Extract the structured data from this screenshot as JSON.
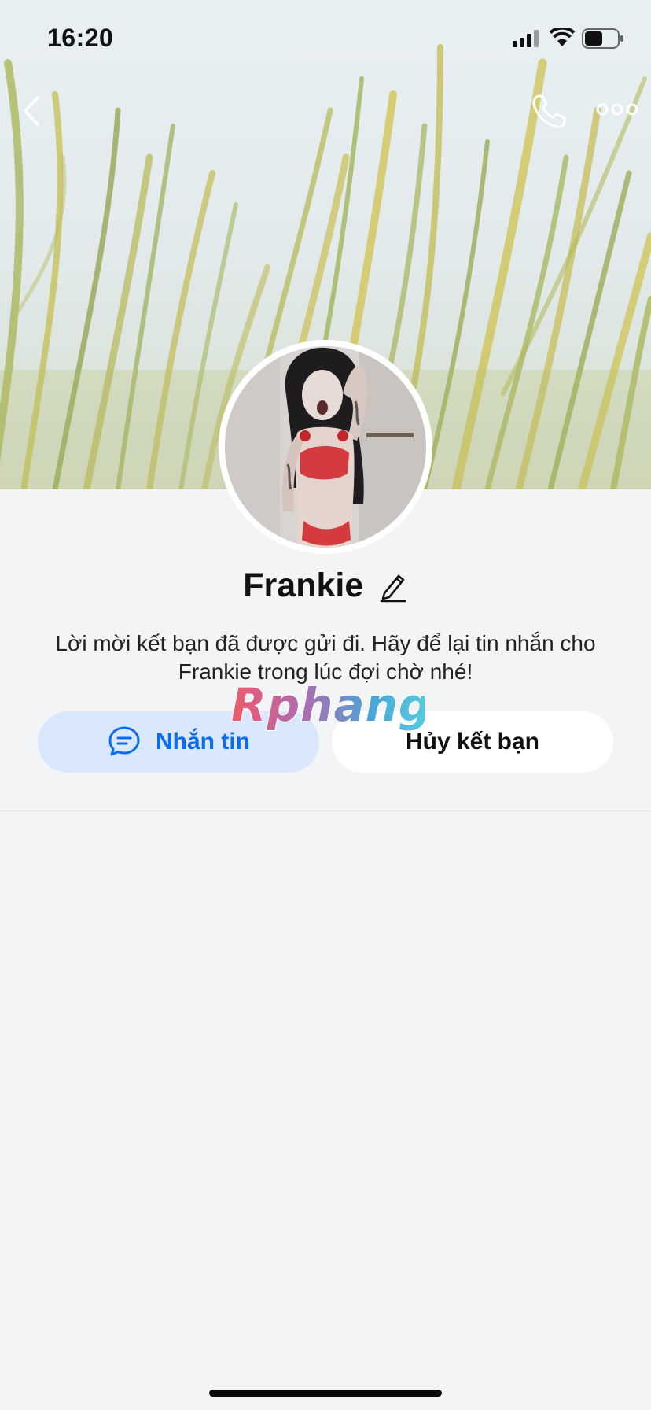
{
  "status_bar": {
    "time": "16:20"
  },
  "nav": {
    "back_icon": "chevron-left-icon",
    "call_icon": "phone-icon",
    "more_icon": "more-dots-icon"
  },
  "profile": {
    "name": "Frankie",
    "description": "Lời mời kết bạn đã được gửi đi. Hãy để lại tin nhắn cho Frankie trong lúc đợi chờ nhé!",
    "edit_icon": "pencil-icon"
  },
  "actions": {
    "message_label": "Nhắn tin",
    "unfriend_label": "Hủy kết bạn"
  },
  "watermark": "Rphang",
  "colors": {
    "accent": "#0a6cf0",
    "message_button_bg": "#d9e8fd",
    "page_bg": "#f3f4f6"
  }
}
